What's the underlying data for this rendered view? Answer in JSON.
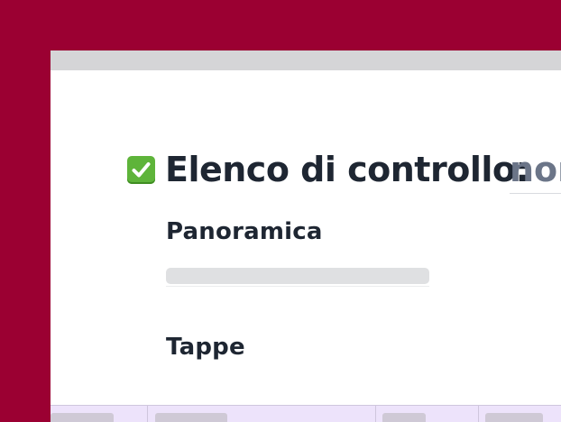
{
  "page": {
    "brand_color": "#9b0032",
    "heading": {
      "icon": "check-box-icon",
      "label": "Elenco di controllo:",
      "input_value": "non"
    },
    "sections": {
      "overview": "Panoramica",
      "steps": "Tappe"
    },
    "table_header_color": "#ede3fb"
  }
}
